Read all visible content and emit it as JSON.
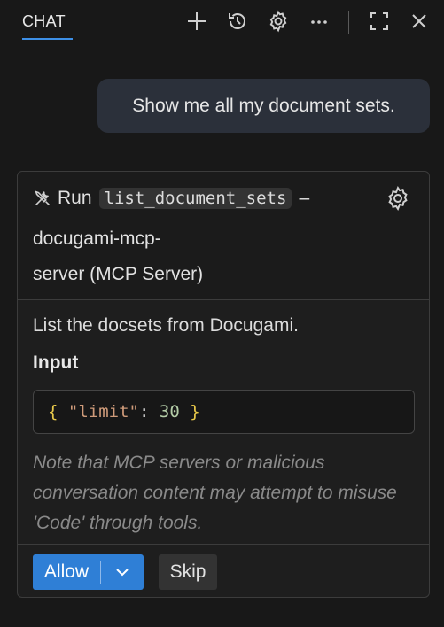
{
  "header": {
    "tab_label": "CHAT",
    "icons": [
      "plus-icon",
      "history-icon",
      "gear-icon",
      "more-icon",
      "maximize-icon",
      "close-icon"
    ]
  },
  "user_message": {
    "text": "Show me all my document sets."
  },
  "tool_card": {
    "run_word": "Run",
    "tool_name": "list_document_sets",
    "dash": "–",
    "server_line1": "docugami-mcp-",
    "server_line2": "server (MCP Server)",
    "description": "List the docsets from Docugami.",
    "input_label": "Input",
    "input_json": {
      "open": "{",
      "key": "\"limit\"",
      "colon": ":",
      "value": "30",
      "close": "}"
    },
    "note": "Note that MCP servers or malicious conversation content may attempt to misuse 'Code' through tools.",
    "allow_label": "Allow",
    "skip_label": "Skip"
  },
  "colors": {
    "background": "#181818",
    "accent": "#2f7fd6",
    "user_bubble": "#2b303a"
  }
}
